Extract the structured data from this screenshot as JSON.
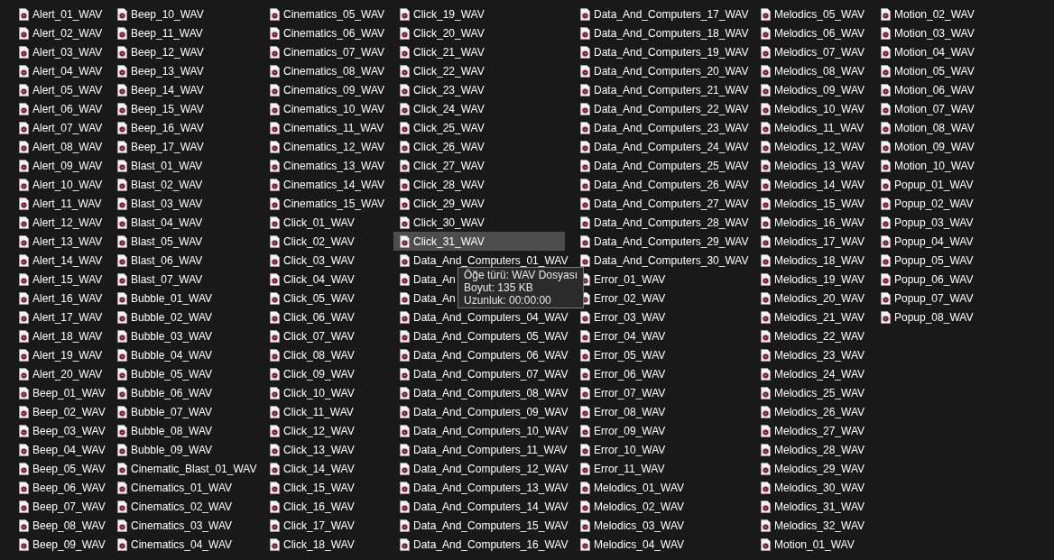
{
  "columns": [
    {
      "items": [
        {
          "name": "Alert_01_WAV",
          "selected": false
        },
        {
          "name": "Alert_02_WAV",
          "selected": false
        },
        {
          "name": "Alert_03_WAV",
          "selected": false
        },
        {
          "name": "Alert_04_WAV",
          "selected": false
        },
        {
          "name": "Alert_05_WAV",
          "selected": false
        },
        {
          "name": "Alert_06_WAV",
          "selected": false
        },
        {
          "name": "Alert_07_WAV",
          "selected": false
        },
        {
          "name": "Alert_08_WAV",
          "selected": false
        },
        {
          "name": "Alert_09_WAV",
          "selected": false
        },
        {
          "name": "Alert_10_WAV",
          "selected": false
        },
        {
          "name": "Alert_11_WAV",
          "selected": false
        },
        {
          "name": "Alert_12_WAV",
          "selected": false
        },
        {
          "name": "Alert_13_WAV",
          "selected": false
        },
        {
          "name": "Alert_14_WAV",
          "selected": false
        },
        {
          "name": "Alert_15_WAV",
          "selected": false
        },
        {
          "name": "Alert_16_WAV",
          "selected": false
        },
        {
          "name": "Alert_17_WAV",
          "selected": false
        },
        {
          "name": "Alert_18_WAV",
          "selected": false
        },
        {
          "name": "Alert_19_WAV",
          "selected": false
        },
        {
          "name": "Alert_20_WAV",
          "selected": false
        },
        {
          "name": "Beep_01_WAV",
          "selected": false
        },
        {
          "name": "Beep_02_WAV",
          "selected": false
        },
        {
          "name": "Beep_03_WAV",
          "selected": false
        },
        {
          "name": "Beep_04_WAV",
          "selected": false
        },
        {
          "name": "Beep_05_WAV",
          "selected": false
        },
        {
          "name": "Beep_06_WAV",
          "selected": false
        },
        {
          "name": "Beep_07_WAV",
          "selected": false
        },
        {
          "name": "Beep_08_WAV",
          "selected": false
        },
        {
          "name": "Beep_09_WAV",
          "selected": false
        }
      ]
    },
    {
      "items": [
        {
          "name": "Beep_10_WAV",
          "selected": false
        },
        {
          "name": "Beep_11_WAV",
          "selected": false
        },
        {
          "name": "Beep_12_WAV",
          "selected": false
        },
        {
          "name": "Beep_13_WAV",
          "selected": false
        },
        {
          "name": "Beep_14_WAV",
          "selected": false
        },
        {
          "name": "Beep_15_WAV",
          "selected": false
        },
        {
          "name": "Beep_16_WAV",
          "selected": false
        },
        {
          "name": "Beep_17_WAV",
          "selected": false
        },
        {
          "name": "Blast_01_WAV",
          "selected": false
        },
        {
          "name": "Blast_02_WAV",
          "selected": false
        },
        {
          "name": "Blast_03_WAV",
          "selected": false
        },
        {
          "name": "Blast_04_WAV",
          "selected": false
        },
        {
          "name": "Blast_05_WAV",
          "selected": false
        },
        {
          "name": "Blast_06_WAV",
          "selected": false
        },
        {
          "name": "Blast_07_WAV",
          "selected": false
        },
        {
          "name": "Bubble_01_WAV",
          "selected": false
        },
        {
          "name": "Bubble_02_WAV",
          "selected": false
        },
        {
          "name": "Bubble_03_WAV",
          "selected": false
        },
        {
          "name": "Bubble_04_WAV",
          "selected": false
        },
        {
          "name": "Bubble_05_WAV",
          "selected": false
        },
        {
          "name": "Bubble_06_WAV",
          "selected": false
        },
        {
          "name": "Bubble_07_WAV",
          "selected": false
        },
        {
          "name": "Bubble_08_WAV",
          "selected": false
        },
        {
          "name": "Bubble_09_WAV",
          "selected": false
        },
        {
          "name": "Cinematic_Blast_01_WAV",
          "selected": false
        },
        {
          "name": "Cinematics_01_WAV",
          "selected": false
        },
        {
          "name": "Cinematics_02_WAV",
          "selected": false
        },
        {
          "name": "Cinematics_03_WAV",
          "selected": false
        },
        {
          "name": "Cinematics_04_WAV",
          "selected": false
        }
      ]
    },
    {
      "items": [
        {
          "name": "Cinematics_05_WAV",
          "selected": false
        },
        {
          "name": "Cinematics_06_WAV",
          "selected": false
        },
        {
          "name": "Cinematics_07_WAV",
          "selected": false
        },
        {
          "name": "Cinematics_08_WAV",
          "selected": false
        },
        {
          "name": "Cinematics_09_WAV",
          "selected": false
        },
        {
          "name": "Cinematics_10_WAV",
          "selected": false
        },
        {
          "name": "Cinematics_11_WAV",
          "selected": false
        },
        {
          "name": "Cinematics_12_WAV",
          "selected": false
        },
        {
          "name": "Cinematics_13_WAV",
          "selected": false
        },
        {
          "name": "Cinematics_14_WAV",
          "selected": false
        },
        {
          "name": "Cinematics_15_WAV",
          "selected": false
        },
        {
          "name": "Click_01_WAV",
          "selected": false
        },
        {
          "name": "Click_02_WAV",
          "selected": false
        },
        {
          "name": "Click_03_WAV",
          "selected": false
        },
        {
          "name": "Click_04_WAV",
          "selected": false
        },
        {
          "name": "Click_05_WAV",
          "selected": false
        },
        {
          "name": "Click_06_WAV",
          "selected": false
        },
        {
          "name": "Click_07_WAV",
          "selected": false
        },
        {
          "name": "Click_08_WAV",
          "selected": false
        },
        {
          "name": "Click_09_WAV",
          "selected": false
        },
        {
          "name": "Click_10_WAV",
          "selected": false
        },
        {
          "name": "Click_11_WAV",
          "selected": false
        },
        {
          "name": "Click_12_WAV",
          "selected": false
        },
        {
          "name": "Click_13_WAV",
          "selected": false
        },
        {
          "name": "Click_14_WAV",
          "selected": false
        },
        {
          "name": "Click_15_WAV",
          "selected": false
        },
        {
          "name": "Click_16_WAV",
          "selected": false
        },
        {
          "name": "Click_17_WAV",
          "selected": false
        },
        {
          "name": "Click_18_WAV",
          "selected": false
        }
      ]
    },
    {
      "items": [
        {
          "name": "Click_19_WAV",
          "selected": false
        },
        {
          "name": "Click_20_WAV",
          "selected": false
        },
        {
          "name": "Click_21_WAV",
          "selected": false
        },
        {
          "name": "Click_22_WAV",
          "selected": false
        },
        {
          "name": "Click_23_WAV",
          "selected": false
        },
        {
          "name": "Click_24_WAV",
          "selected": false
        },
        {
          "name": "Click_25_WAV",
          "selected": false
        },
        {
          "name": "Click_26_WAV",
          "selected": false
        },
        {
          "name": "Click_27_WAV",
          "selected": false
        },
        {
          "name": "Click_28_WAV",
          "selected": false
        },
        {
          "name": "Click_29_WAV",
          "selected": false
        },
        {
          "name": "Click_30_WAV",
          "selected": false
        },
        {
          "name": "Click_31_WAV",
          "selected": true
        },
        {
          "name": "Data_And_Computers_01_WAV",
          "selected": false
        },
        {
          "name": "Data_An",
          "selected": false
        },
        {
          "name": "Data_An",
          "selected": false
        },
        {
          "name": "Data_And_Computers_04_WAV",
          "selected": false
        },
        {
          "name": "Data_And_Computers_05_WAV",
          "selected": false
        },
        {
          "name": "Data_And_Computers_06_WAV",
          "selected": false
        },
        {
          "name": "Data_And_Computers_07_WAV",
          "selected": false
        },
        {
          "name": "Data_And_Computers_08_WAV",
          "selected": false
        },
        {
          "name": "Data_And_Computers_09_WAV",
          "selected": false
        },
        {
          "name": "Data_And_Computers_10_WAV",
          "selected": false
        },
        {
          "name": "Data_And_Computers_11_WAV",
          "selected": false
        },
        {
          "name": "Data_And_Computers_12_WAV",
          "selected": false
        },
        {
          "name": "Data_And_Computers_13_WAV",
          "selected": false
        },
        {
          "name": "Data_And_Computers_14_WAV",
          "selected": false
        },
        {
          "name": "Data_And_Computers_15_WAV",
          "selected": false
        },
        {
          "name": "Data_And_Computers_16_WAV",
          "selected": false
        }
      ]
    },
    {
      "items": [
        {
          "name": "Data_And_Computers_17_WAV",
          "selected": false
        },
        {
          "name": "Data_And_Computers_18_WAV",
          "selected": false
        },
        {
          "name": "Data_And_Computers_19_WAV",
          "selected": false
        },
        {
          "name": "Data_And_Computers_20_WAV",
          "selected": false
        },
        {
          "name": "Data_And_Computers_21_WAV",
          "selected": false
        },
        {
          "name": "Data_And_Computers_22_WAV",
          "selected": false
        },
        {
          "name": "Data_And_Computers_23_WAV",
          "selected": false
        },
        {
          "name": "Data_And_Computers_24_WAV",
          "selected": false
        },
        {
          "name": "Data_And_Computers_25_WAV",
          "selected": false
        },
        {
          "name": "Data_And_Computers_26_WAV",
          "selected": false
        },
        {
          "name": "Data_And_Computers_27_WAV",
          "selected": false
        },
        {
          "name": "Data_And_Computers_28_WAV",
          "selected": false
        },
        {
          "name": "Data_And_Computers_29_WAV",
          "selected": false
        },
        {
          "name": "Data_And_Computers_30_WAV",
          "selected": false
        },
        {
          "name": "Error_01_WAV",
          "selected": false
        },
        {
          "name": "Error_02_WAV",
          "selected": false
        },
        {
          "name": "Error_03_WAV",
          "selected": false
        },
        {
          "name": "Error_04_WAV",
          "selected": false
        },
        {
          "name": "Error_05_WAV",
          "selected": false
        },
        {
          "name": "Error_06_WAV",
          "selected": false
        },
        {
          "name": "Error_07_WAV",
          "selected": false
        },
        {
          "name": "Error_08_WAV",
          "selected": false
        },
        {
          "name": "Error_09_WAV",
          "selected": false
        },
        {
          "name": "Error_10_WAV",
          "selected": false
        },
        {
          "name": "Error_11_WAV",
          "selected": false
        },
        {
          "name": "Melodics_01_WAV",
          "selected": false
        },
        {
          "name": "Melodics_02_WAV",
          "selected": false
        },
        {
          "name": "Melodics_03_WAV",
          "selected": false
        },
        {
          "name": "Melodics_04_WAV",
          "selected": false
        }
      ]
    },
    {
      "items": [
        {
          "name": "Melodics_05_WAV",
          "selected": false
        },
        {
          "name": "Melodics_06_WAV",
          "selected": false
        },
        {
          "name": "Melodics_07_WAV",
          "selected": false
        },
        {
          "name": "Melodics_08_WAV",
          "selected": false
        },
        {
          "name": "Melodics_09_WAV",
          "selected": false
        },
        {
          "name": "Melodics_10_WAV",
          "selected": false
        },
        {
          "name": "Melodics_11_WAV",
          "selected": false
        },
        {
          "name": "Melodics_12_WAV",
          "selected": false
        },
        {
          "name": "Melodics_13_WAV",
          "selected": false
        },
        {
          "name": "Melodics_14_WAV",
          "selected": false
        },
        {
          "name": "Melodics_15_WAV",
          "selected": false
        },
        {
          "name": "Melodics_16_WAV",
          "selected": false
        },
        {
          "name": "Melodics_17_WAV",
          "selected": false
        },
        {
          "name": "Melodics_18_WAV",
          "selected": false
        },
        {
          "name": "Melodics_19_WAV",
          "selected": false
        },
        {
          "name": "Melodics_20_WAV",
          "selected": false
        },
        {
          "name": "Melodics_21_WAV",
          "selected": false
        },
        {
          "name": "Melodics_22_WAV",
          "selected": false
        },
        {
          "name": "Melodics_23_WAV",
          "selected": false
        },
        {
          "name": "Melodics_24_WAV",
          "selected": false
        },
        {
          "name": "Melodics_25_WAV",
          "selected": false
        },
        {
          "name": "Melodics_26_WAV",
          "selected": false
        },
        {
          "name": "Melodics_27_WAV",
          "selected": false
        },
        {
          "name": "Melodics_28_WAV",
          "selected": false
        },
        {
          "name": "Melodics_29_WAV",
          "selected": false
        },
        {
          "name": "Melodics_30_WAV",
          "selected": false
        },
        {
          "name": "Melodics_31_WAV",
          "selected": false
        },
        {
          "name": "Melodics_32_WAV",
          "selected": false
        },
        {
          "name": "Motion_01_WAV",
          "selected": false
        }
      ]
    },
    {
      "items": [
        {
          "name": "Motion_02_WAV",
          "selected": false
        },
        {
          "name": "Motion_03_WAV",
          "selected": false
        },
        {
          "name": "Motion_04_WAV",
          "selected": false
        },
        {
          "name": "Motion_05_WAV",
          "selected": false
        },
        {
          "name": "Motion_06_WAV",
          "selected": false
        },
        {
          "name": "Motion_07_WAV",
          "selected": false
        },
        {
          "name": "Motion_08_WAV",
          "selected": false
        },
        {
          "name": "Motion_09_WAV",
          "selected": false
        },
        {
          "name": "Motion_10_WAV",
          "selected": false
        },
        {
          "name": "Popup_01_WAV",
          "selected": false
        },
        {
          "name": "Popup_02_WAV",
          "selected": false
        },
        {
          "name": "Popup_03_WAV",
          "selected": false
        },
        {
          "name": "Popup_04_WAV",
          "selected": false
        },
        {
          "name": "Popup_05_WAV",
          "selected": false
        },
        {
          "name": "Popup_06_WAV",
          "selected": false
        },
        {
          "name": "Popup_07_WAV",
          "selected": false
        },
        {
          "name": "Popup_08_WAV",
          "selected": false
        }
      ]
    }
  ],
  "tooltip": {
    "lines": [
      "Öğe türü: WAV Dosyası",
      "Boyut: 135 KB",
      "Uzunluk: 00:00:00"
    ]
  }
}
